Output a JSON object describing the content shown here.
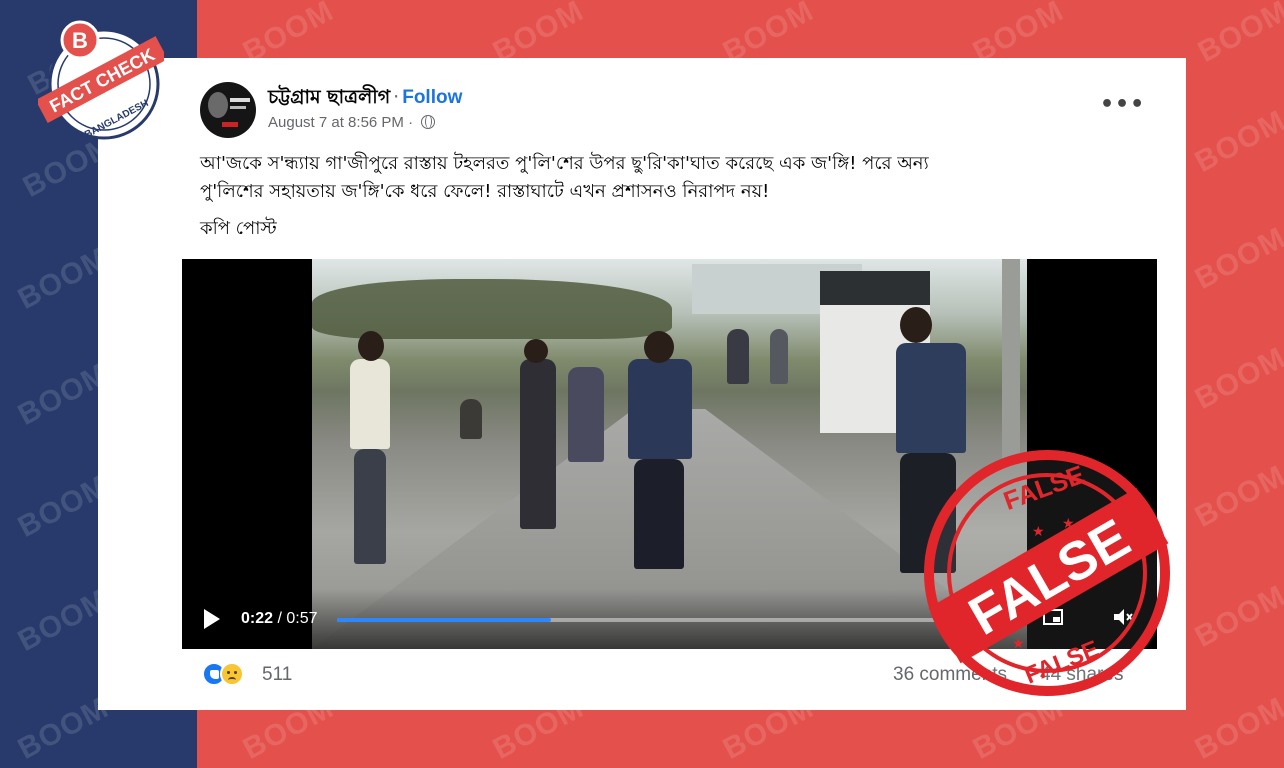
{
  "colors": {
    "left_band": "#273a6b",
    "right_band": "#e4504b",
    "fb_blue": "#1b74e4",
    "stamp_red": "#e1262b"
  },
  "watermark_text": "BOOM",
  "badge": {
    "letter": "B",
    "line1": "FACT CHECK",
    "line2": "BANGLADESH"
  },
  "post": {
    "page_name": "চট্টগ্রাম ছাত্রলীগ",
    "separator": "·",
    "follow_label": "Follow",
    "date": "August 7 at 8:56 PM",
    "date_sep": "·",
    "privacy_icon": "globe-icon",
    "more_label": "•••",
    "text_line1": "আ'জকে স'ন্ধ্যায় গা'জীপুরে রাস্তায় টহলরত পু'লি'শের উপর ছু'রি'কা'ঘাত করেছে এক জ'ঙ্গি! পরে অন্য",
    "text_line2": "পু'লিশের সহায়তায় জ'ঙ্গি'কে ধরে ফেলে! রাস্তাঘাটে এখন প্রশাসনও নিরাপদ নয়!",
    "copy_label": "কপি পোস্ট"
  },
  "video": {
    "current_time": "0:22",
    "time_sep": "/",
    "duration": "0:57",
    "progress": 0.31,
    "play_icon": "play-icon",
    "settings_icon": "settings-icon",
    "pip_icon": "pip-icon",
    "volume_icon": "volume-icon"
  },
  "footer": {
    "reaction_count": "511",
    "comments": "36 comments",
    "shares": "44 shares",
    "reaction_icons": [
      "like-icon",
      "sad-icon"
    ]
  },
  "stamp": {
    "word_top": "FALSE",
    "word_main": "FALSE",
    "word_bottom": "FALSE"
  }
}
